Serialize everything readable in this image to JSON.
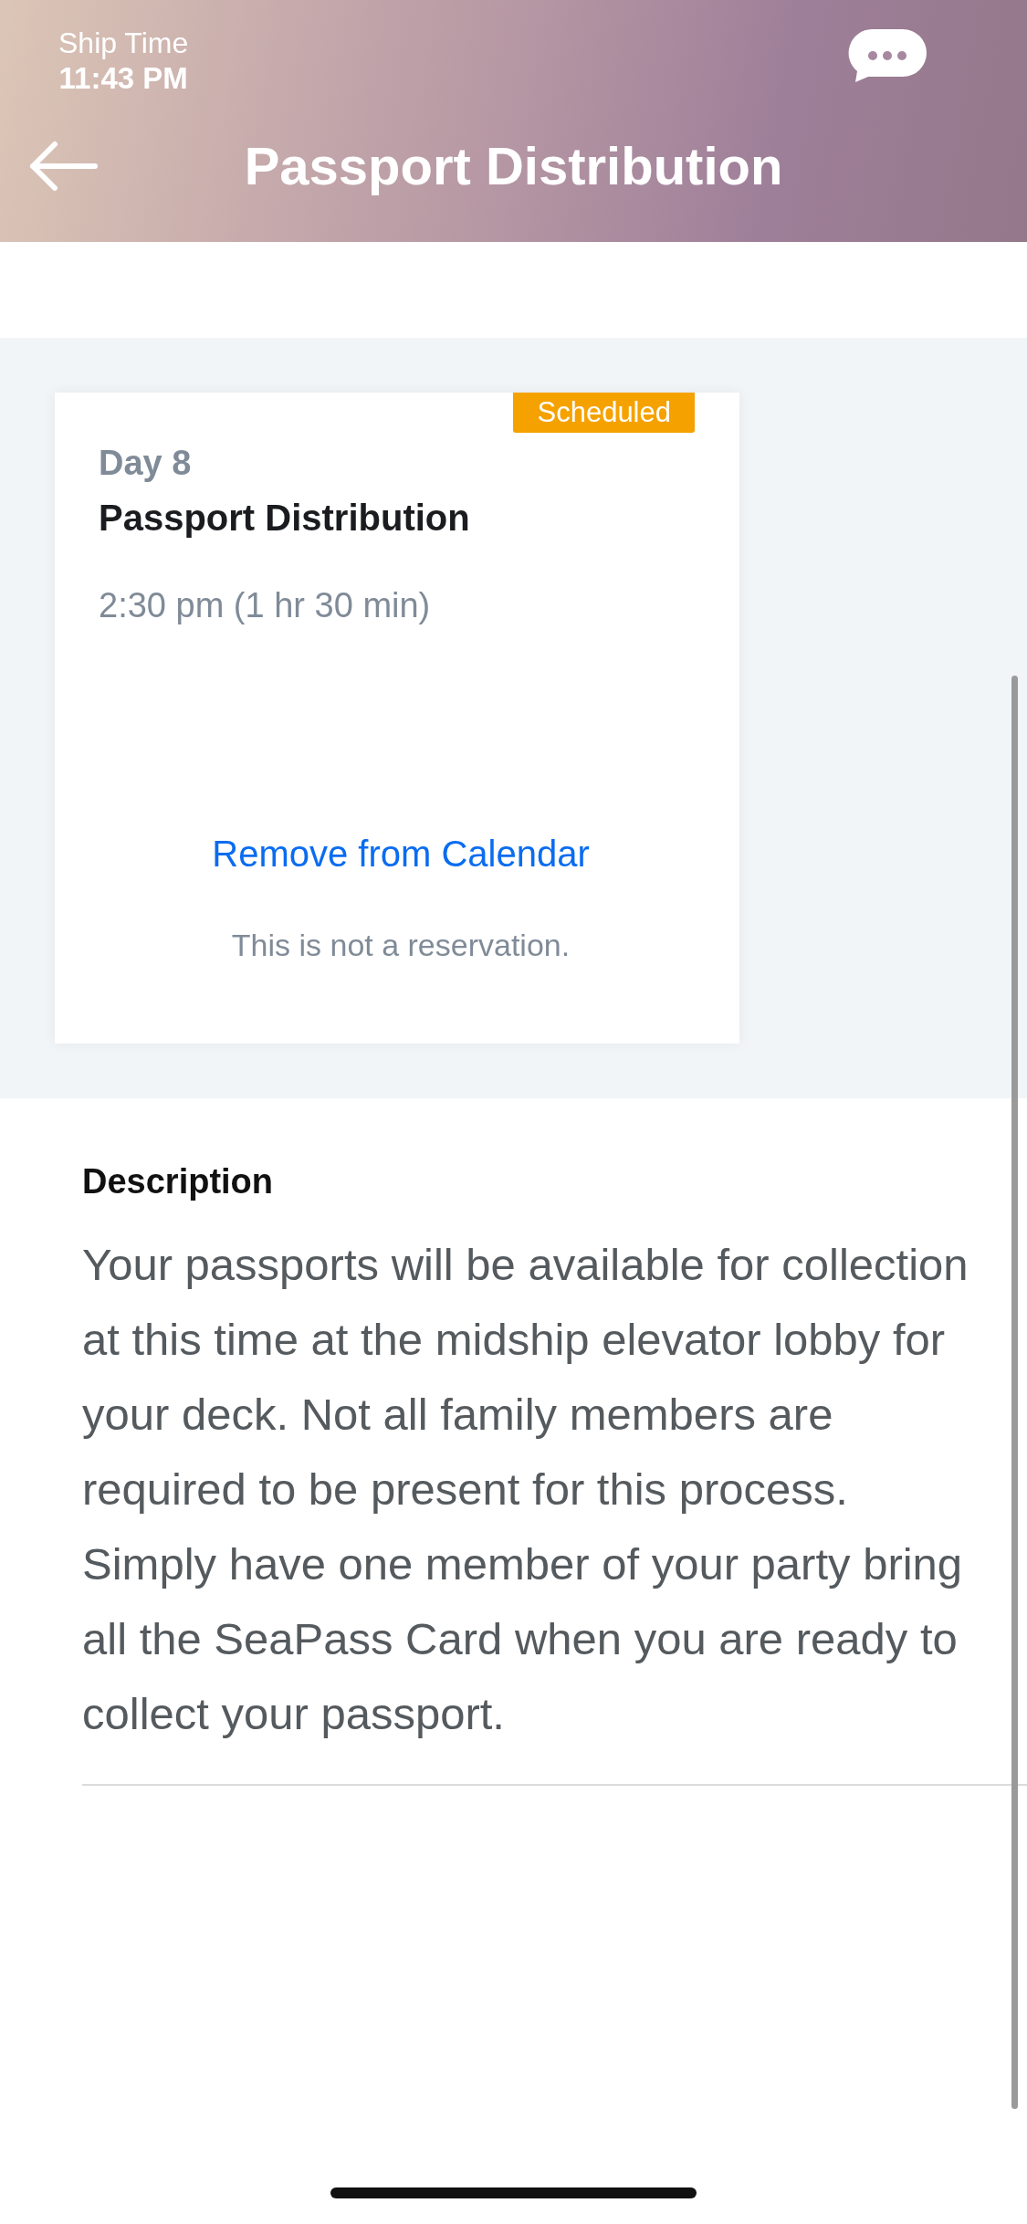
{
  "header": {
    "ship_time_label": "Ship Time",
    "ship_time": "11:43 PM",
    "title": "Passport Distribution"
  },
  "event_card": {
    "status": "Scheduled",
    "day": "Day 8",
    "title": "Passport Distribution",
    "time": "2:30 pm (1 hr 30 min)",
    "action": "Remove from Calendar",
    "note": "This is not a reservation."
  },
  "description": {
    "heading": "Description",
    "text": "Your passports will be available for collection at this time at the midship elevator lobby for your deck. Not all family members are required to be present for this process. Simply have one member of your party bring all the SeaPass Card when you are ready to collect your passport."
  }
}
